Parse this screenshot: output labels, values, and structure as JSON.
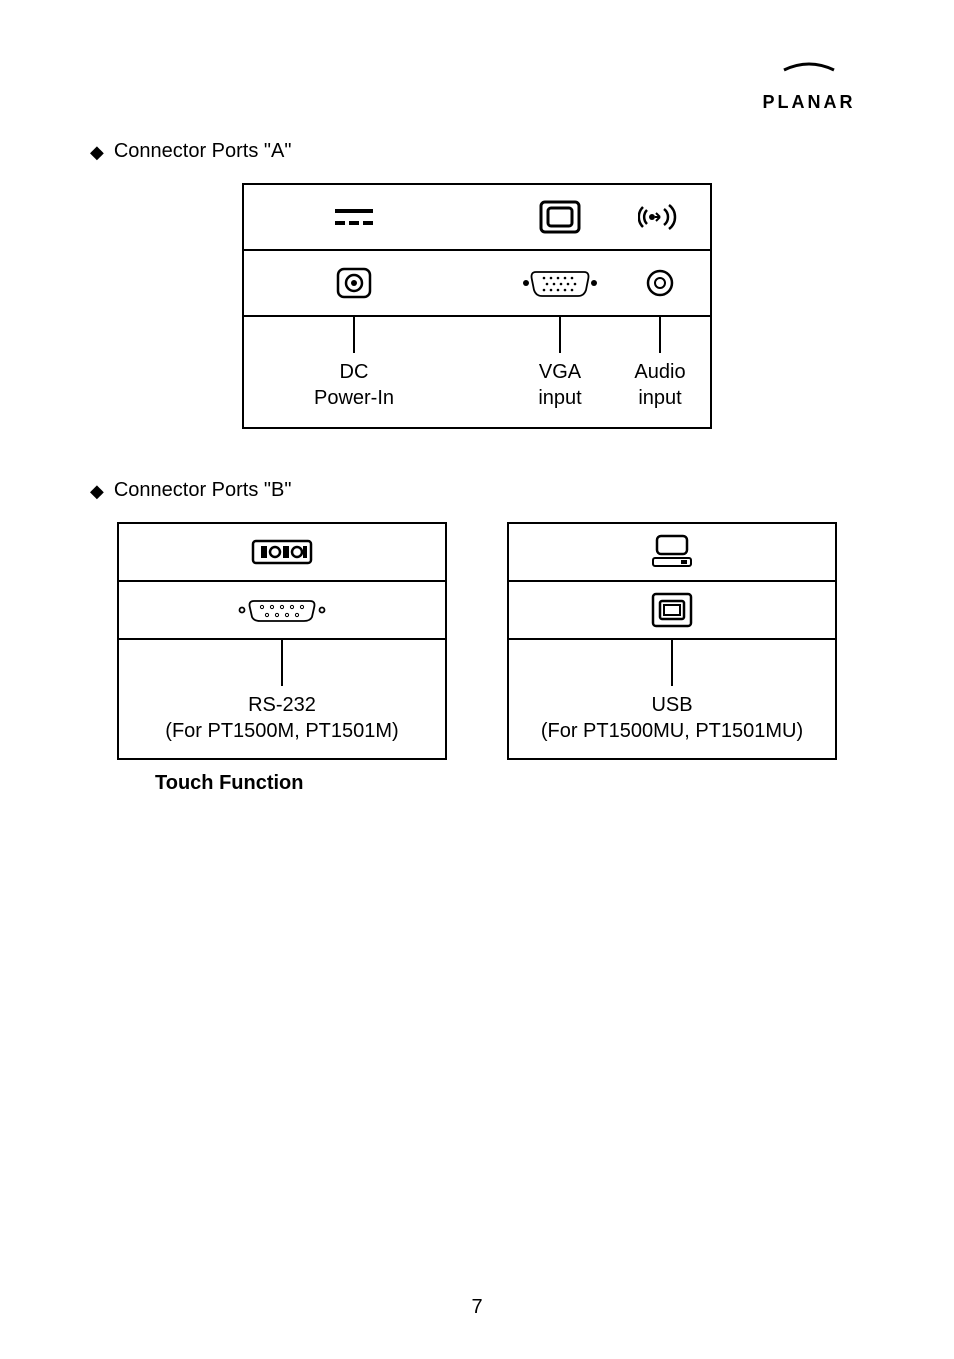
{
  "brand": "PLANAR",
  "sectionA": {
    "title": "Connector Ports \"A\"",
    "ports": {
      "dc": {
        "line1": "DC",
        "line2": "Power-In"
      },
      "vga": {
        "line1": "VGA",
        "line2": "input"
      },
      "audio": {
        "line1": "Audio",
        "line2": "input"
      }
    }
  },
  "sectionB": {
    "title": "Connector Ports \"B\"",
    "left": {
      "line1": "RS-232",
      "line2": "(For PT1500M, PT1501M)"
    },
    "right": {
      "line1": "USB",
      "line2": "(For PT1500MU, PT1501MU)"
    },
    "footer": "Touch Function"
  },
  "pageNumber": "7"
}
